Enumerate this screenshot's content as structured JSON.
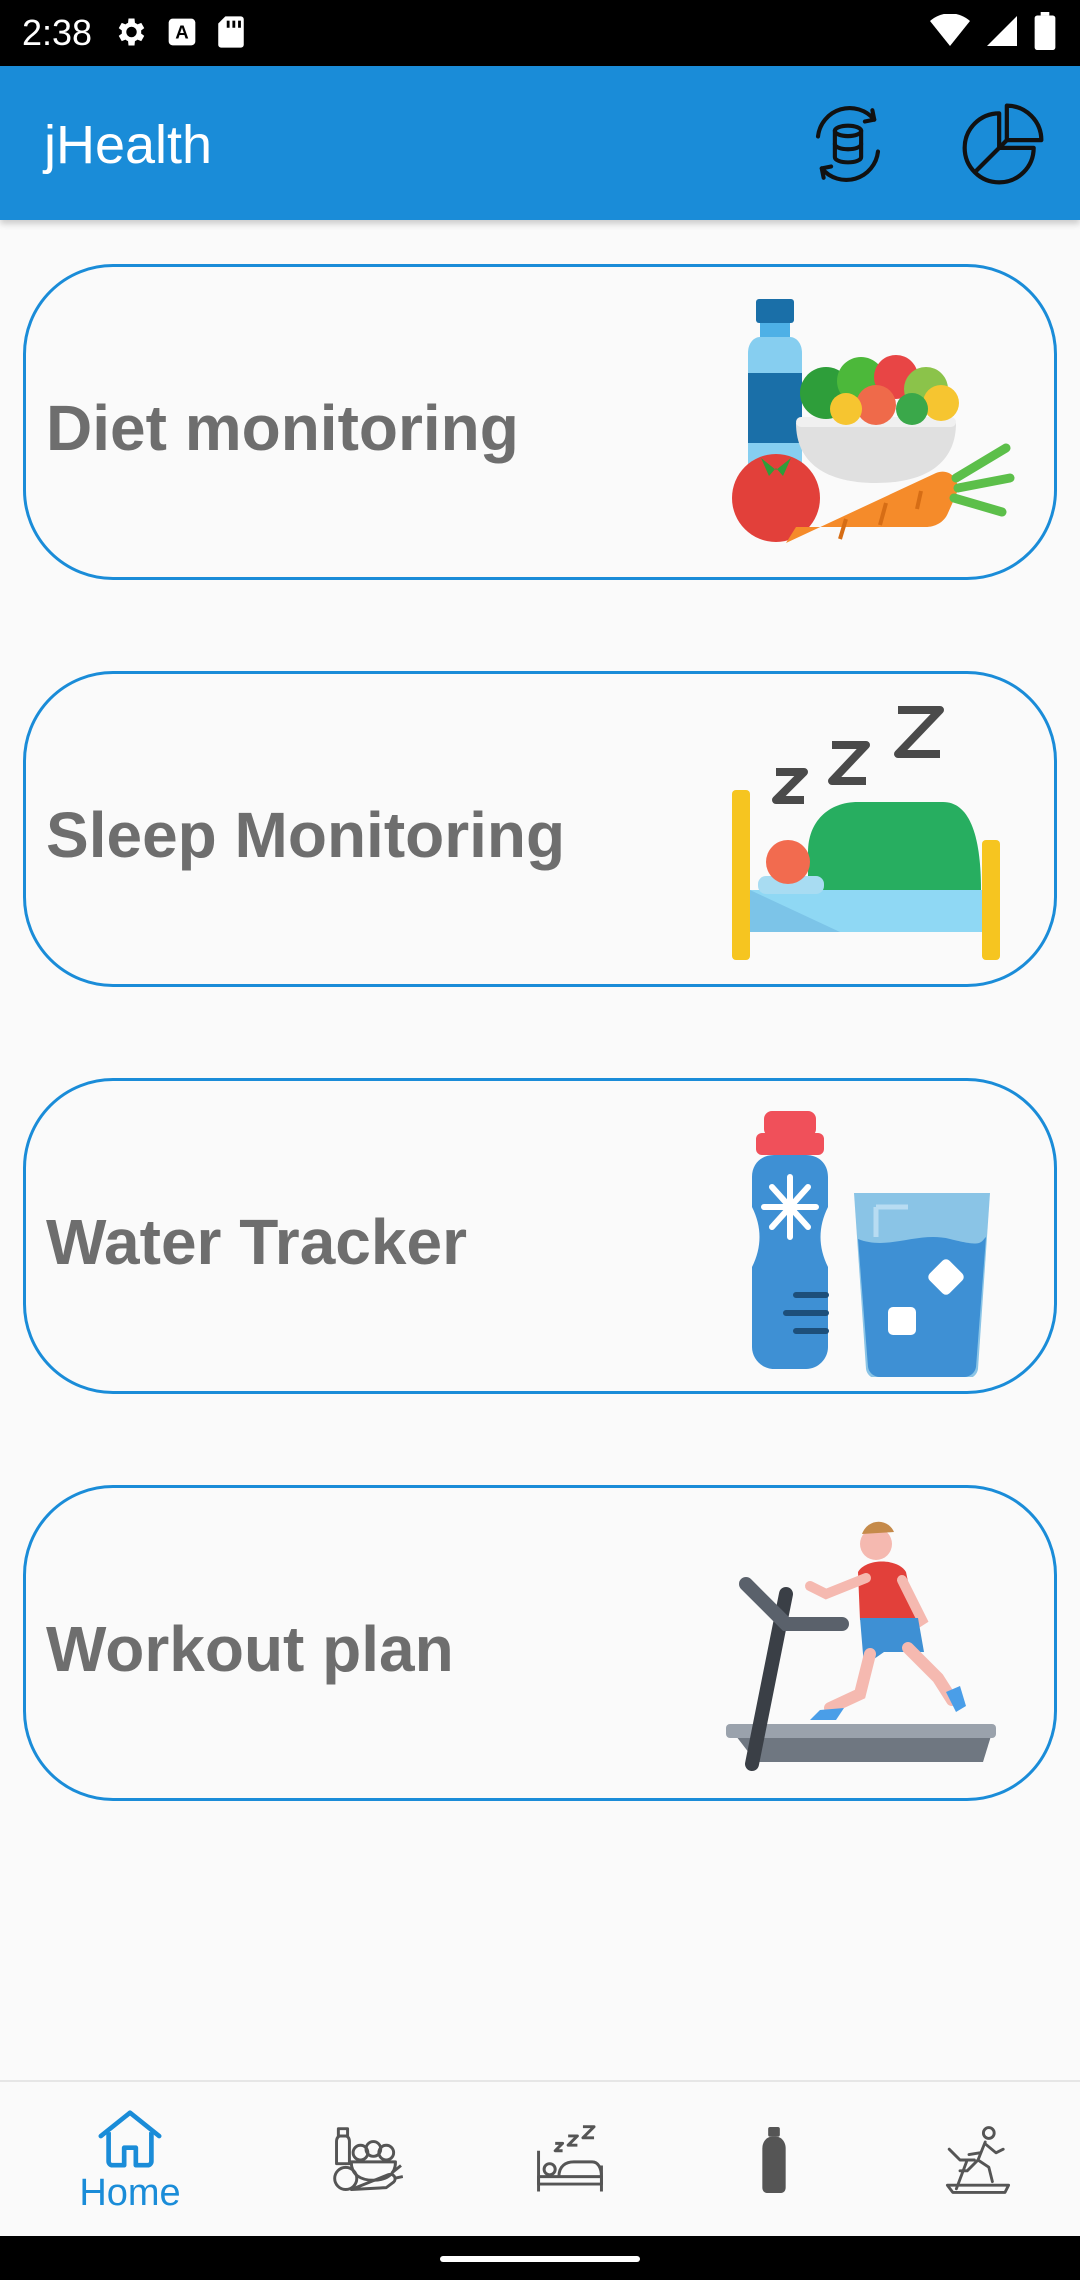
{
  "status_bar": {
    "time": "2:38",
    "icons": [
      "settings-icon",
      "a-badge-icon",
      "sd-card-icon",
      "wifi-icon",
      "signal-icon",
      "battery-icon"
    ]
  },
  "app_bar": {
    "title": "jHealth",
    "actions": [
      "database-sync-icon",
      "pie-chart-icon"
    ],
    "background_color": "#1a8cd8"
  },
  "cards": [
    {
      "label": "Diet monitoring",
      "icon": "diet-illustration"
    },
    {
      "label": "Sleep Monitoring",
      "icon": "sleep-illustration"
    },
    {
      "label": "Water Tracker",
      "icon": "water-illustration"
    },
    {
      "label": "Workout plan",
      "icon": "workout-illustration"
    }
  ],
  "bottom_nav": {
    "items": [
      {
        "label": "Home",
        "icon": "home-icon",
        "selected": true
      },
      {
        "icon": "diet-icon",
        "selected": false
      },
      {
        "icon": "sleep-icon",
        "selected": false
      },
      {
        "icon": "water-bottle-icon",
        "selected": false
      },
      {
        "icon": "treadmill-icon",
        "selected": false
      }
    ],
    "accent_color": "#1a8cd8"
  }
}
